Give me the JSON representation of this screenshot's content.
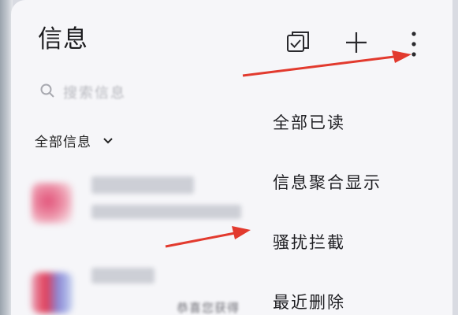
{
  "header": {
    "title": "信息"
  },
  "icons": {
    "select": "checkbox-select-icon",
    "add": "plus-icon",
    "more": "more-vertical-icon",
    "search": "search-icon",
    "chevron": "chevron-down-icon"
  },
  "search": {
    "placeholder": "搜索信息"
  },
  "filter": {
    "label": "全部信息"
  },
  "conversations": [
    {
      "snippet": ""
    },
    {
      "snippet": "恭喜您获得"
    }
  ],
  "menu": {
    "items": [
      {
        "label": "全部已读"
      },
      {
        "label": "信息聚合显示"
      },
      {
        "label": "骚扰拦截"
      },
      {
        "label": "最近删除"
      }
    ]
  },
  "colors": {
    "background": "#f6f6f9",
    "text": "#1f1f23",
    "annotation_arrow": "#e23a2e"
  }
}
